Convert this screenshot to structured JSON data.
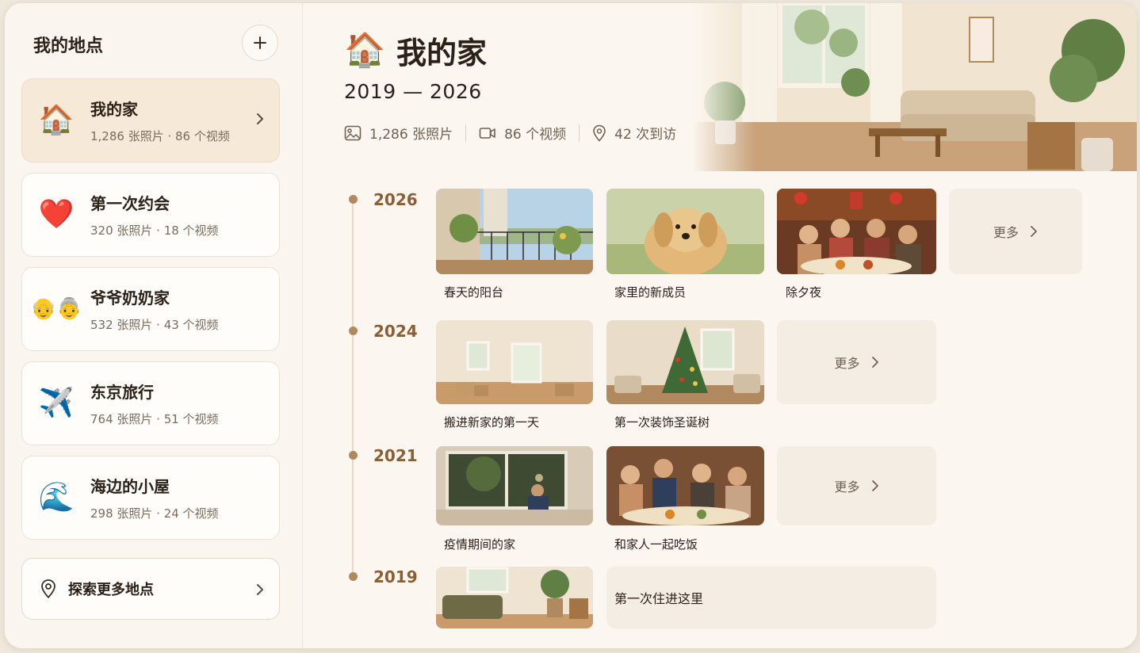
{
  "sidebar": {
    "title": "我的地点",
    "add_icon": "plus-icon",
    "places": [
      {
        "emoji": "🏠",
        "name": "我的家",
        "meta": "1,286 张照片 · 86 个视频",
        "active": true
      },
      {
        "emoji": "❤️",
        "name": "第一次约会",
        "meta": "320 张照片 · 18 个视频",
        "active": false
      },
      {
        "emoji": "👴👵",
        "name": "爷爷奶奶家",
        "meta": "532 张照片 · 43 个视频",
        "active": false
      },
      {
        "emoji": "✈️",
        "name": "东京旅行",
        "meta": "764 张照片 · 51 个视频",
        "active": false
      },
      {
        "emoji": "🌊",
        "name": "海边的小屋",
        "meta": "298 张照片 · 24 个视频",
        "active": false
      }
    ],
    "explore_label": "探索更多地点"
  },
  "hero": {
    "icon": "🏠",
    "title": "我的家",
    "years": "2019 — 2026",
    "stats": {
      "photos": "1,286 张照片",
      "videos": "86 个视频",
      "visits": "42 次到访"
    }
  },
  "timeline": {
    "y2026": {
      "year": "2026",
      "captions": [
        "春天的阳台",
        "家里的新成员",
        "除夕夜"
      ],
      "more": "更多"
    },
    "y2024": {
      "year": "2024",
      "captions": [
        "搬进新家的第一天",
        "第一次装饰圣诞树"
      ],
      "more": "更多"
    },
    "y2021": {
      "year": "2021",
      "captions": [
        "疫情期间的家",
        "和家人一起吃饭"
      ],
      "more": "更多"
    },
    "y2019": {
      "year": "2019",
      "note": "第一次住进这里"
    }
  },
  "colors": {
    "accent": "#8a5f33",
    "active_card": "#f6e9d8",
    "background": "#fbf6ef"
  }
}
